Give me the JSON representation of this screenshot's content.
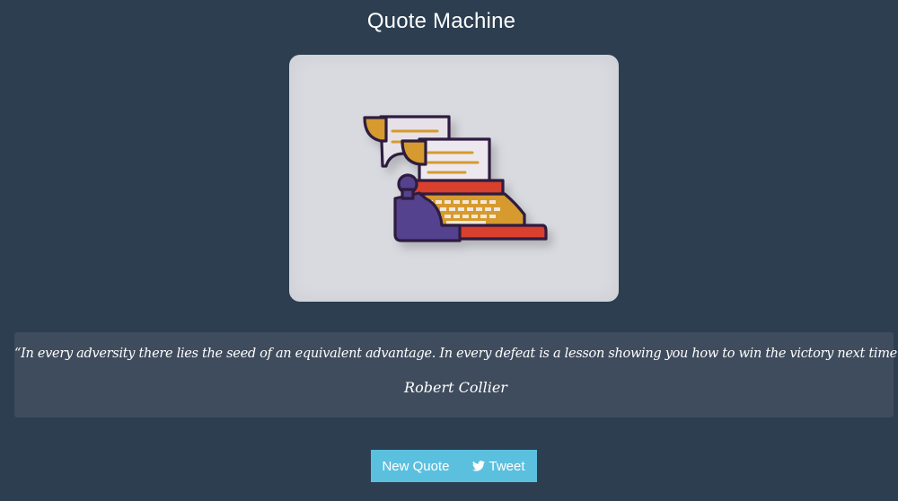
{
  "header": {
    "title": "Quote Machine"
  },
  "quote": {
    "text": "“In every adversity there lies the seed of an equivalent advantage. In every defeat is a lesson showing you how to win the victory next time. ”",
    "author": "Robert Collier"
  },
  "actions": {
    "new_quote_label": "New Quote",
    "tweet_label": "Tweet"
  },
  "icons": {
    "tweet": "twitter-bird-icon",
    "illustration": "typewriter-illustration"
  },
  "colors": {
    "background": "#2c3e50",
    "card": "#d8dadf",
    "quote_box": "#3f4c5d",
    "button": "#5bc0de"
  }
}
